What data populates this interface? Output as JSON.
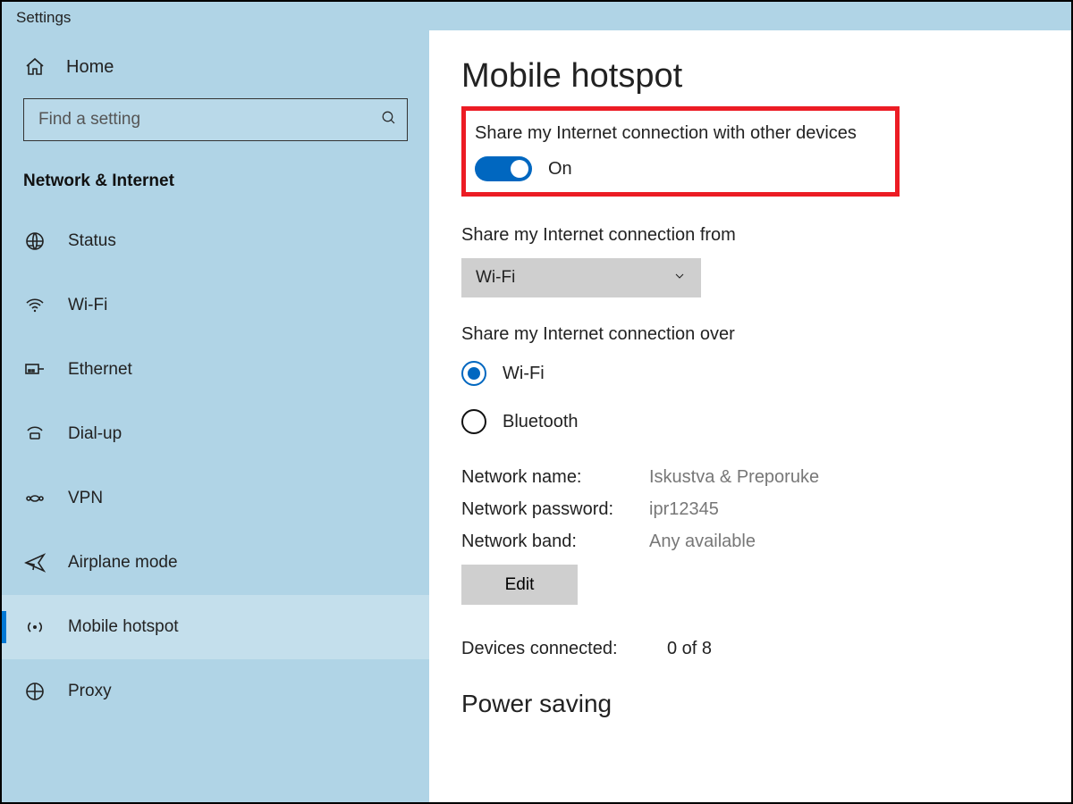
{
  "window": {
    "title": "Settings"
  },
  "sidebar": {
    "home_label": "Home",
    "search_placeholder": "Find a setting",
    "category": "Network & Internet",
    "items": [
      {
        "label": "Status"
      },
      {
        "label": "Wi-Fi"
      },
      {
        "label": "Ethernet"
      },
      {
        "label": "Dial-up"
      },
      {
        "label": "VPN"
      },
      {
        "label": "Airplane mode"
      },
      {
        "label": "Mobile hotspot"
      },
      {
        "label": "Proxy"
      }
    ]
  },
  "page": {
    "title": "Mobile hotspot",
    "share_toggle": {
      "label": "Share my Internet connection with other devices",
      "state": "On"
    },
    "share_from": {
      "label": "Share my Internet connection from",
      "selected": "Wi-Fi"
    },
    "share_over": {
      "label": "Share my Internet connection over",
      "options": {
        "wifi": "Wi-Fi",
        "bluetooth": "Bluetooth"
      },
      "selected": "wifi"
    },
    "network": {
      "name_label": "Network name:",
      "name_value": "Iskustva & Preporuke",
      "password_label": "Network password:",
      "password_value": "ipr12345",
      "band_label": "Network band:",
      "band_value": "Any available",
      "edit_label": "Edit"
    },
    "devices": {
      "label": "Devices connected:",
      "value": "0 of 8"
    },
    "next_section": "Power saving"
  }
}
